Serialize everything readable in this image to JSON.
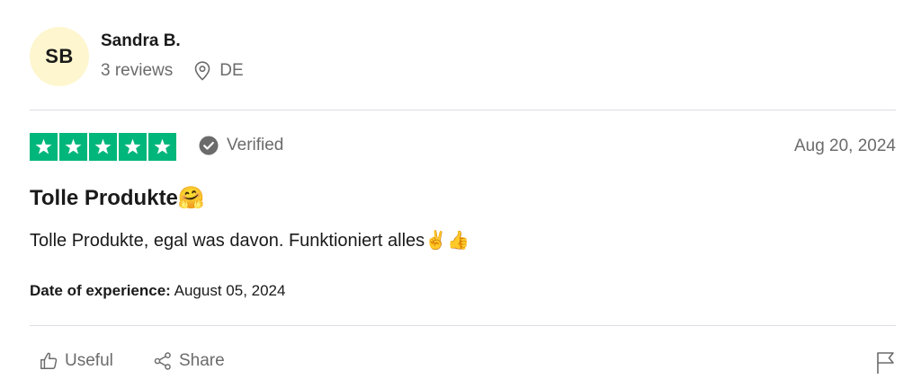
{
  "reviewer": {
    "initials": "SB",
    "name": "Sandra B.",
    "reviews_count": "3 reviews",
    "country": "DE",
    "avatar_color": "#fdf6cf"
  },
  "rating": {
    "stars": 5,
    "max_stars": 5,
    "star_color": "#00b67a",
    "verified_label": "Verified",
    "date": "Aug 20, 2024"
  },
  "review": {
    "title": "Tolle Produkte🤗",
    "body": "Tolle Produkte, egal was davon. Funktioniert alles✌️👍",
    "experience_label": "Date of experience:",
    "experience_date": "August 05, 2024"
  },
  "actions": {
    "useful_label": "Useful",
    "share_label": "Share",
    "icons": {
      "useful": "thumbs-up-icon",
      "share": "share-icon",
      "report": "flag-icon"
    }
  }
}
